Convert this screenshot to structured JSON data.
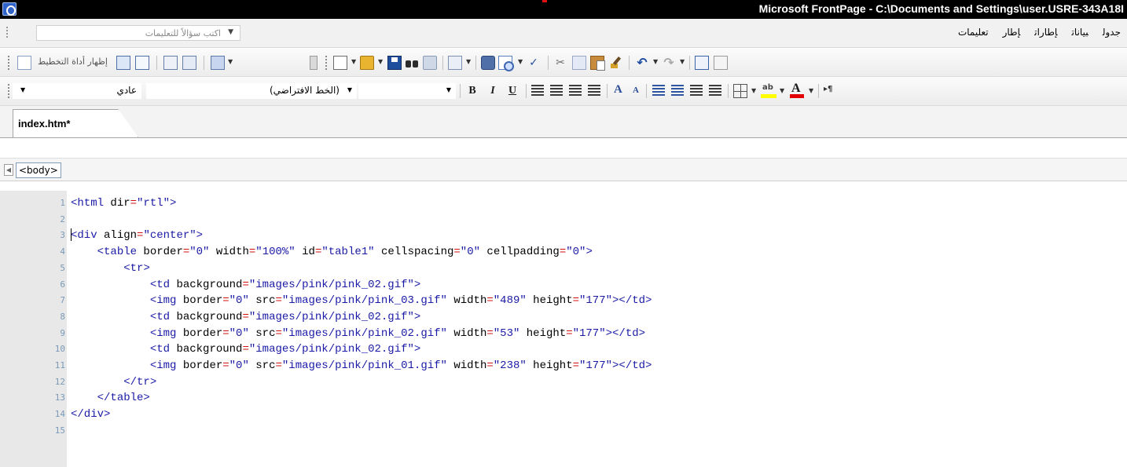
{
  "window": {
    "title": "Microsoft FrontPage - C:\\Documents and Settings\\user.USRE-343A18I"
  },
  "menubar": {
    "help_placeholder": "اكتب سؤالاً للتعليمات",
    "items": [
      "جدول",
      "بيانات",
      "إطارات",
      "إطار",
      "تعليمات"
    ]
  },
  "toolbar": {
    "show_drawing_tool_label": "إظهار أداة التخطيط"
  },
  "format_toolbar": {
    "style_value": "عادي",
    "font_value": "(الخط الافتراضي)",
    "bold": "B",
    "italic": "I",
    "underline": "U",
    "grow_font": "A",
    "shrink_font": "A",
    "highlight_label": "ab",
    "font_color_letter": "A",
    "rtl_label": "▸¶"
  },
  "tabs": [
    {
      "label": "index.htm*"
    }
  ],
  "tag_selector": {
    "tag": "<body>"
  },
  "editor": {
    "line_numbers": [
      "1",
      "2",
      "3",
      "4",
      "5",
      "6",
      "7",
      "8",
      "9",
      "10",
      "11",
      "12",
      "13",
      "14",
      "15"
    ],
    "lines": [
      "<html dir=\"rtl\">",
      "",
      "<div align=\"center\">",
      "    <table border=\"0\" width=\"100%\" id=\"table1\" cellspacing=\"0\" cellpadding=\"0\">",
      "        <tr>",
      "            <td background=\"images/pink/pink_02.gif\">",
      "            <img border=\"0\" src=\"images/pink/pink_03.gif\" width=\"489\" height=\"177\"></td>",
      "            <td background=\"images/pink/pink_02.gif\">",
      "            <img border=\"0\" src=\"images/pink/pink_02.gif\" width=\"53\" height=\"177\"></td>",
      "            <td background=\"images/pink/pink_02.gif\">",
      "            <img border=\"0\" src=\"images/pink/pink_01.gif\" width=\"238\" height=\"177\"></td>",
      "        </tr>",
      "    </table>",
      "</div>",
      ""
    ]
  },
  "colors": {
    "tag": "#1a1aa6",
    "attribute": "#d20f0f",
    "gutter": "#e8e8e8",
    "titlebar": "#000000"
  }
}
